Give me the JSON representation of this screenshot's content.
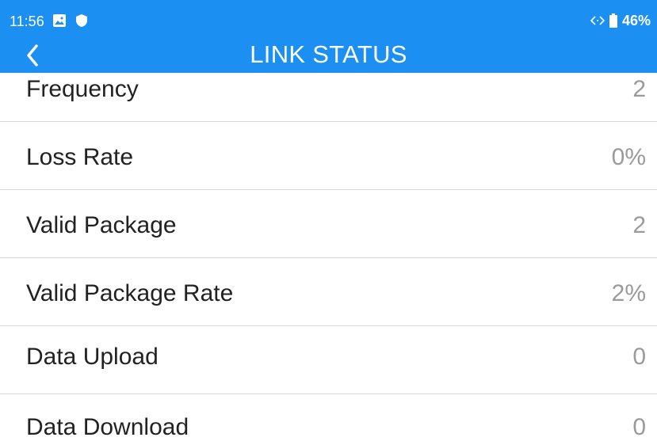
{
  "status_bar": {
    "time": "11:56",
    "image_icon": "image-icon",
    "shield_icon": "shield-icon",
    "link_icon": "link-arrows-icon",
    "battery_icon": "battery-icon",
    "battery_percent": "46%"
  },
  "header": {
    "title": "LINK STATUS",
    "back_icon": "chevron-left-icon",
    "background_color": "#1b90f2"
  },
  "items": [
    {
      "label": "Frequency",
      "value": "2"
    },
    {
      "label": "Loss Rate",
      "value": "0%"
    },
    {
      "label": "Valid Package",
      "value": "2"
    },
    {
      "label": "Valid Package Rate",
      "value": "2%"
    },
    {
      "label": "Data Upload",
      "value": "0"
    },
    {
      "label": "Data Download",
      "value": "0"
    }
  ]
}
